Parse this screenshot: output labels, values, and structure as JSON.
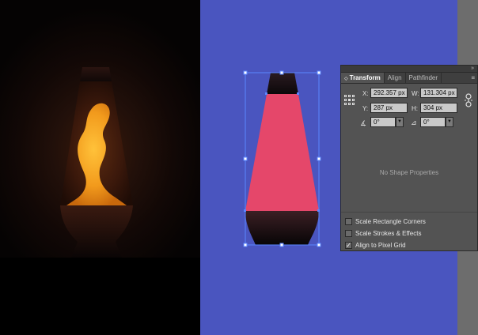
{
  "panel": {
    "tabs": [
      {
        "label": "Transform",
        "active": true
      },
      {
        "label": "Align",
        "active": false
      },
      {
        "label": "Pathfinder",
        "active": false
      }
    ],
    "x_label": "X:",
    "x_value": "292.357 px",
    "w_label": "W:",
    "w_value": "131.304 px",
    "y_label": "Y:",
    "y_value": "287 px",
    "h_label": "H:",
    "h_value": "304 px",
    "rotate_value": "0°",
    "shear_value": "0°",
    "no_shape_text": "No Shape Properties",
    "options": [
      {
        "label": "Scale Rectangle Corners",
        "checked": false
      },
      {
        "label": "Scale Strokes & Effects",
        "checked": false
      },
      {
        "label": "Align to Pixel Grid",
        "checked": true
      }
    ]
  },
  "colors": {
    "artboard": "#4a55bf",
    "lamp_body": "#e5476a",
    "lamp_glow": "#f09020",
    "panel_bg": "#535353",
    "selection": "#4a7dff"
  },
  "icons": {
    "panel_collapse": "double-chevron-right-icon",
    "panel_menu": "panel-menu-icon",
    "reference_point": "reference-point-grid-icon",
    "constrain": "chain-link-icon",
    "rotate": "rotate-angle-icon",
    "shear": "shear-angle-icon"
  }
}
